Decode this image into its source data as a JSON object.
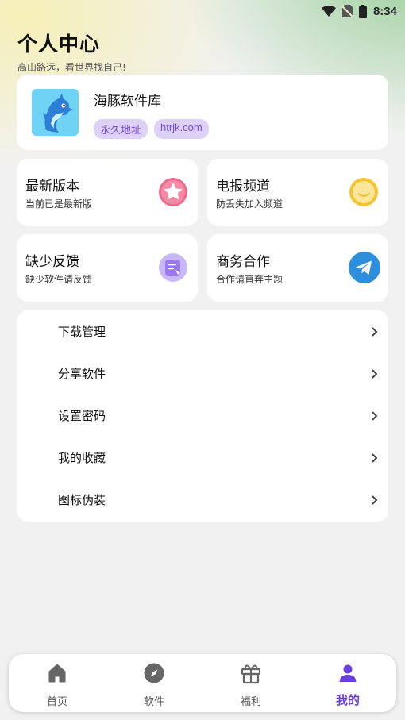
{
  "status_bar": {
    "time": "8:34",
    "icons": [
      "wifi-icon",
      "no-sim-icon",
      "battery-icon"
    ]
  },
  "header": {
    "title": "个人中心",
    "subtitle": "高山路远，看世界找自己!"
  },
  "profile": {
    "name": "海豚软件库",
    "avatar": "dolphin-avatar",
    "tags": [
      "永久地址",
      "htrjk.com"
    ]
  },
  "grid": [
    {
      "title": "最新版本",
      "subtitle": "当前已是最新版",
      "icon": "star-icon",
      "color": "#f06a8e"
    },
    {
      "title": "电报频道",
      "subtitle": "防丢失加入频道",
      "icon": "chat-bubble-icon",
      "color": "#f4c431"
    },
    {
      "title": "缺少反馈",
      "subtitle": "缺少软件请反馈",
      "icon": "feedback-icon",
      "color": "#9b7af0"
    },
    {
      "title": "商务合作",
      "subtitle": "合作请直奔主题",
      "icon": "telegram-icon",
      "color": "#2d8fdc"
    }
  ],
  "menu": [
    {
      "label": "下载管理"
    },
    {
      "label": "分享软件"
    },
    {
      "label": "设置密码"
    },
    {
      "label": "我的收藏"
    },
    {
      "label": "图标伪装"
    }
  ],
  "tabs": [
    {
      "label": "首页",
      "icon": "home-icon"
    },
    {
      "label": "软件",
      "icon": "compass-icon"
    },
    {
      "label": "福利",
      "icon": "gift-icon"
    },
    {
      "label": "我的",
      "icon": "user-icon",
      "active": true
    }
  ],
  "colors": {
    "accent": "#6a3fe0",
    "tag_bg": "#ddd2f5",
    "tag_text": "#7a4fd6"
  }
}
